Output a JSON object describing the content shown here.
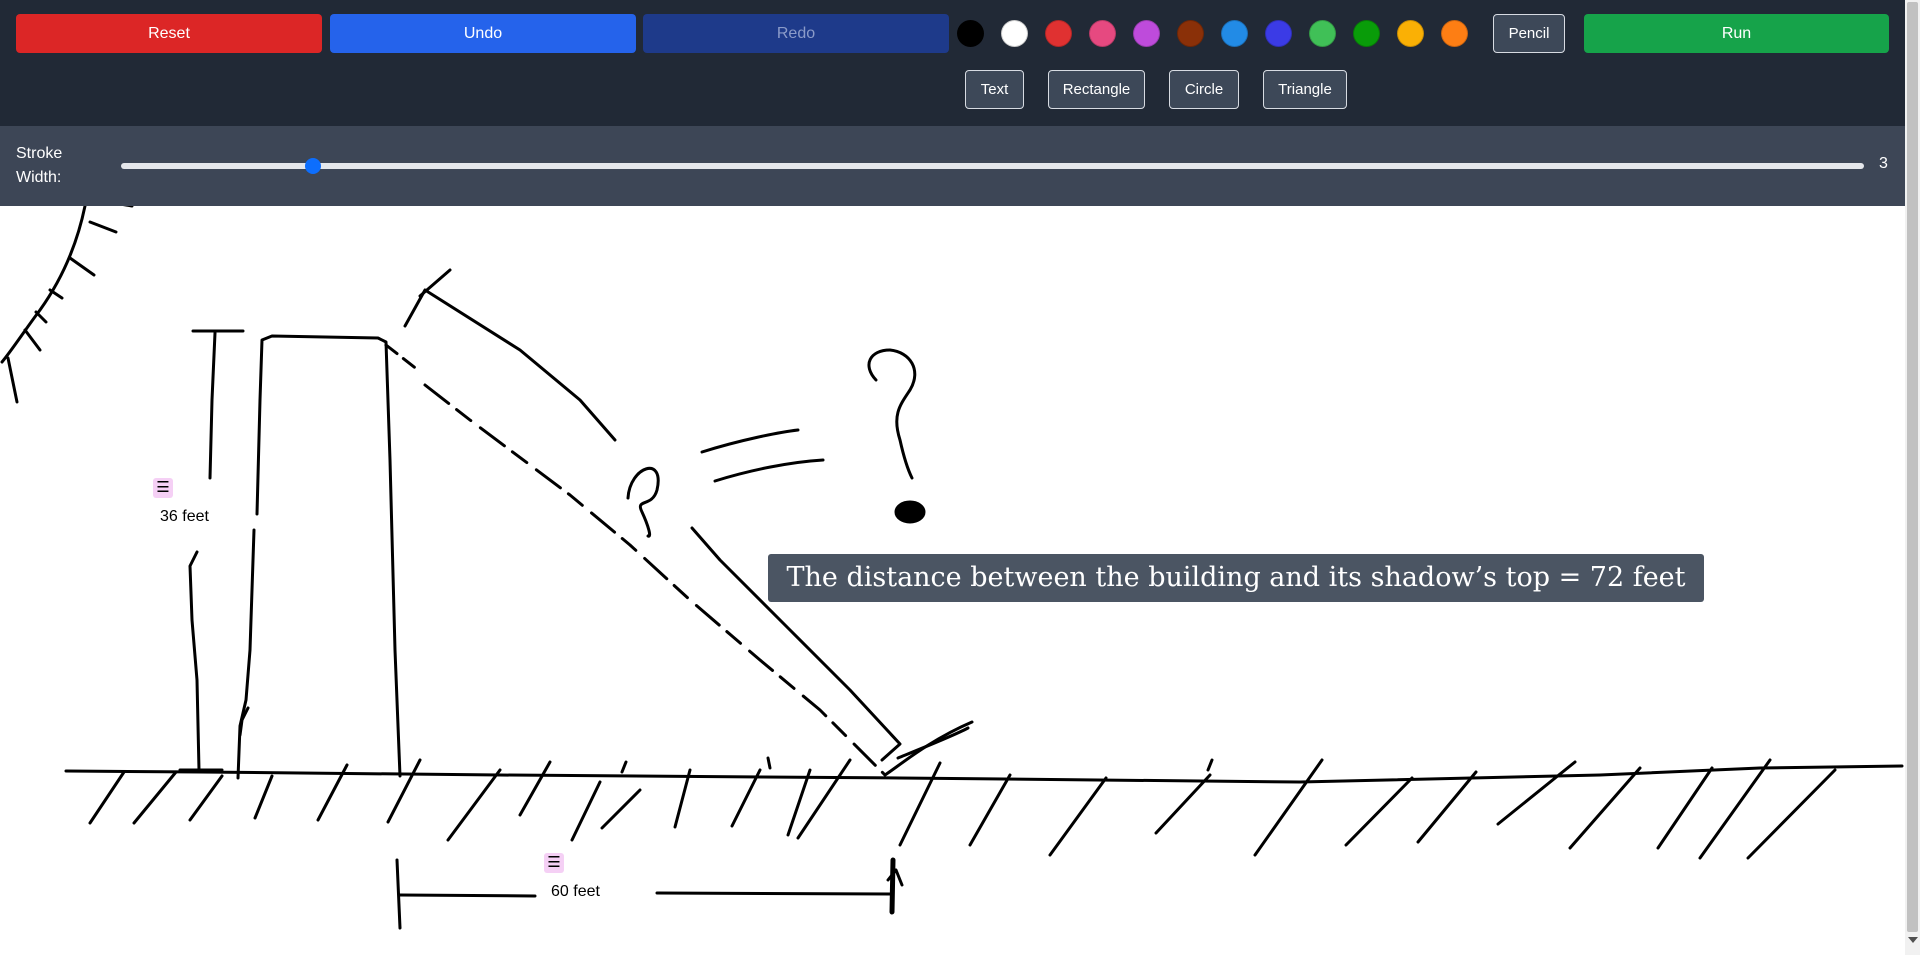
{
  "toolbar": {
    "reset_label": "Reset",
    "undo_label": "Undo",
    "redo_label": "Redo",
    "run_label": "Run",
    "pencil_label": "Pencil",
    "shape_tools": [
      "Text",
      "Rectangle",
      "Circle",
      "Triangle"
    ],
    "colors": [
      "#000000",
      "#ffffff",
      "#e03131",
      "#e64980",
      "#be4bdb",
      "#8a3008",
      "#228be6",
      "#3b3be6",
      "#40c057",
      "#099c09",
      "#fab005",
      "#fd7e14"
    ]
  },
  "stroke": {
    "label": "Stroke Width:",
    "value": "3",
    "slider_fraction": 0.11
  },
  "canvas": {
    "labels": {
      "height": "36 feet",
      "shadow": "60 feet"
    },
    "equation": "The distance between the building and its shadow’s top = 72 feet"
  }
}
